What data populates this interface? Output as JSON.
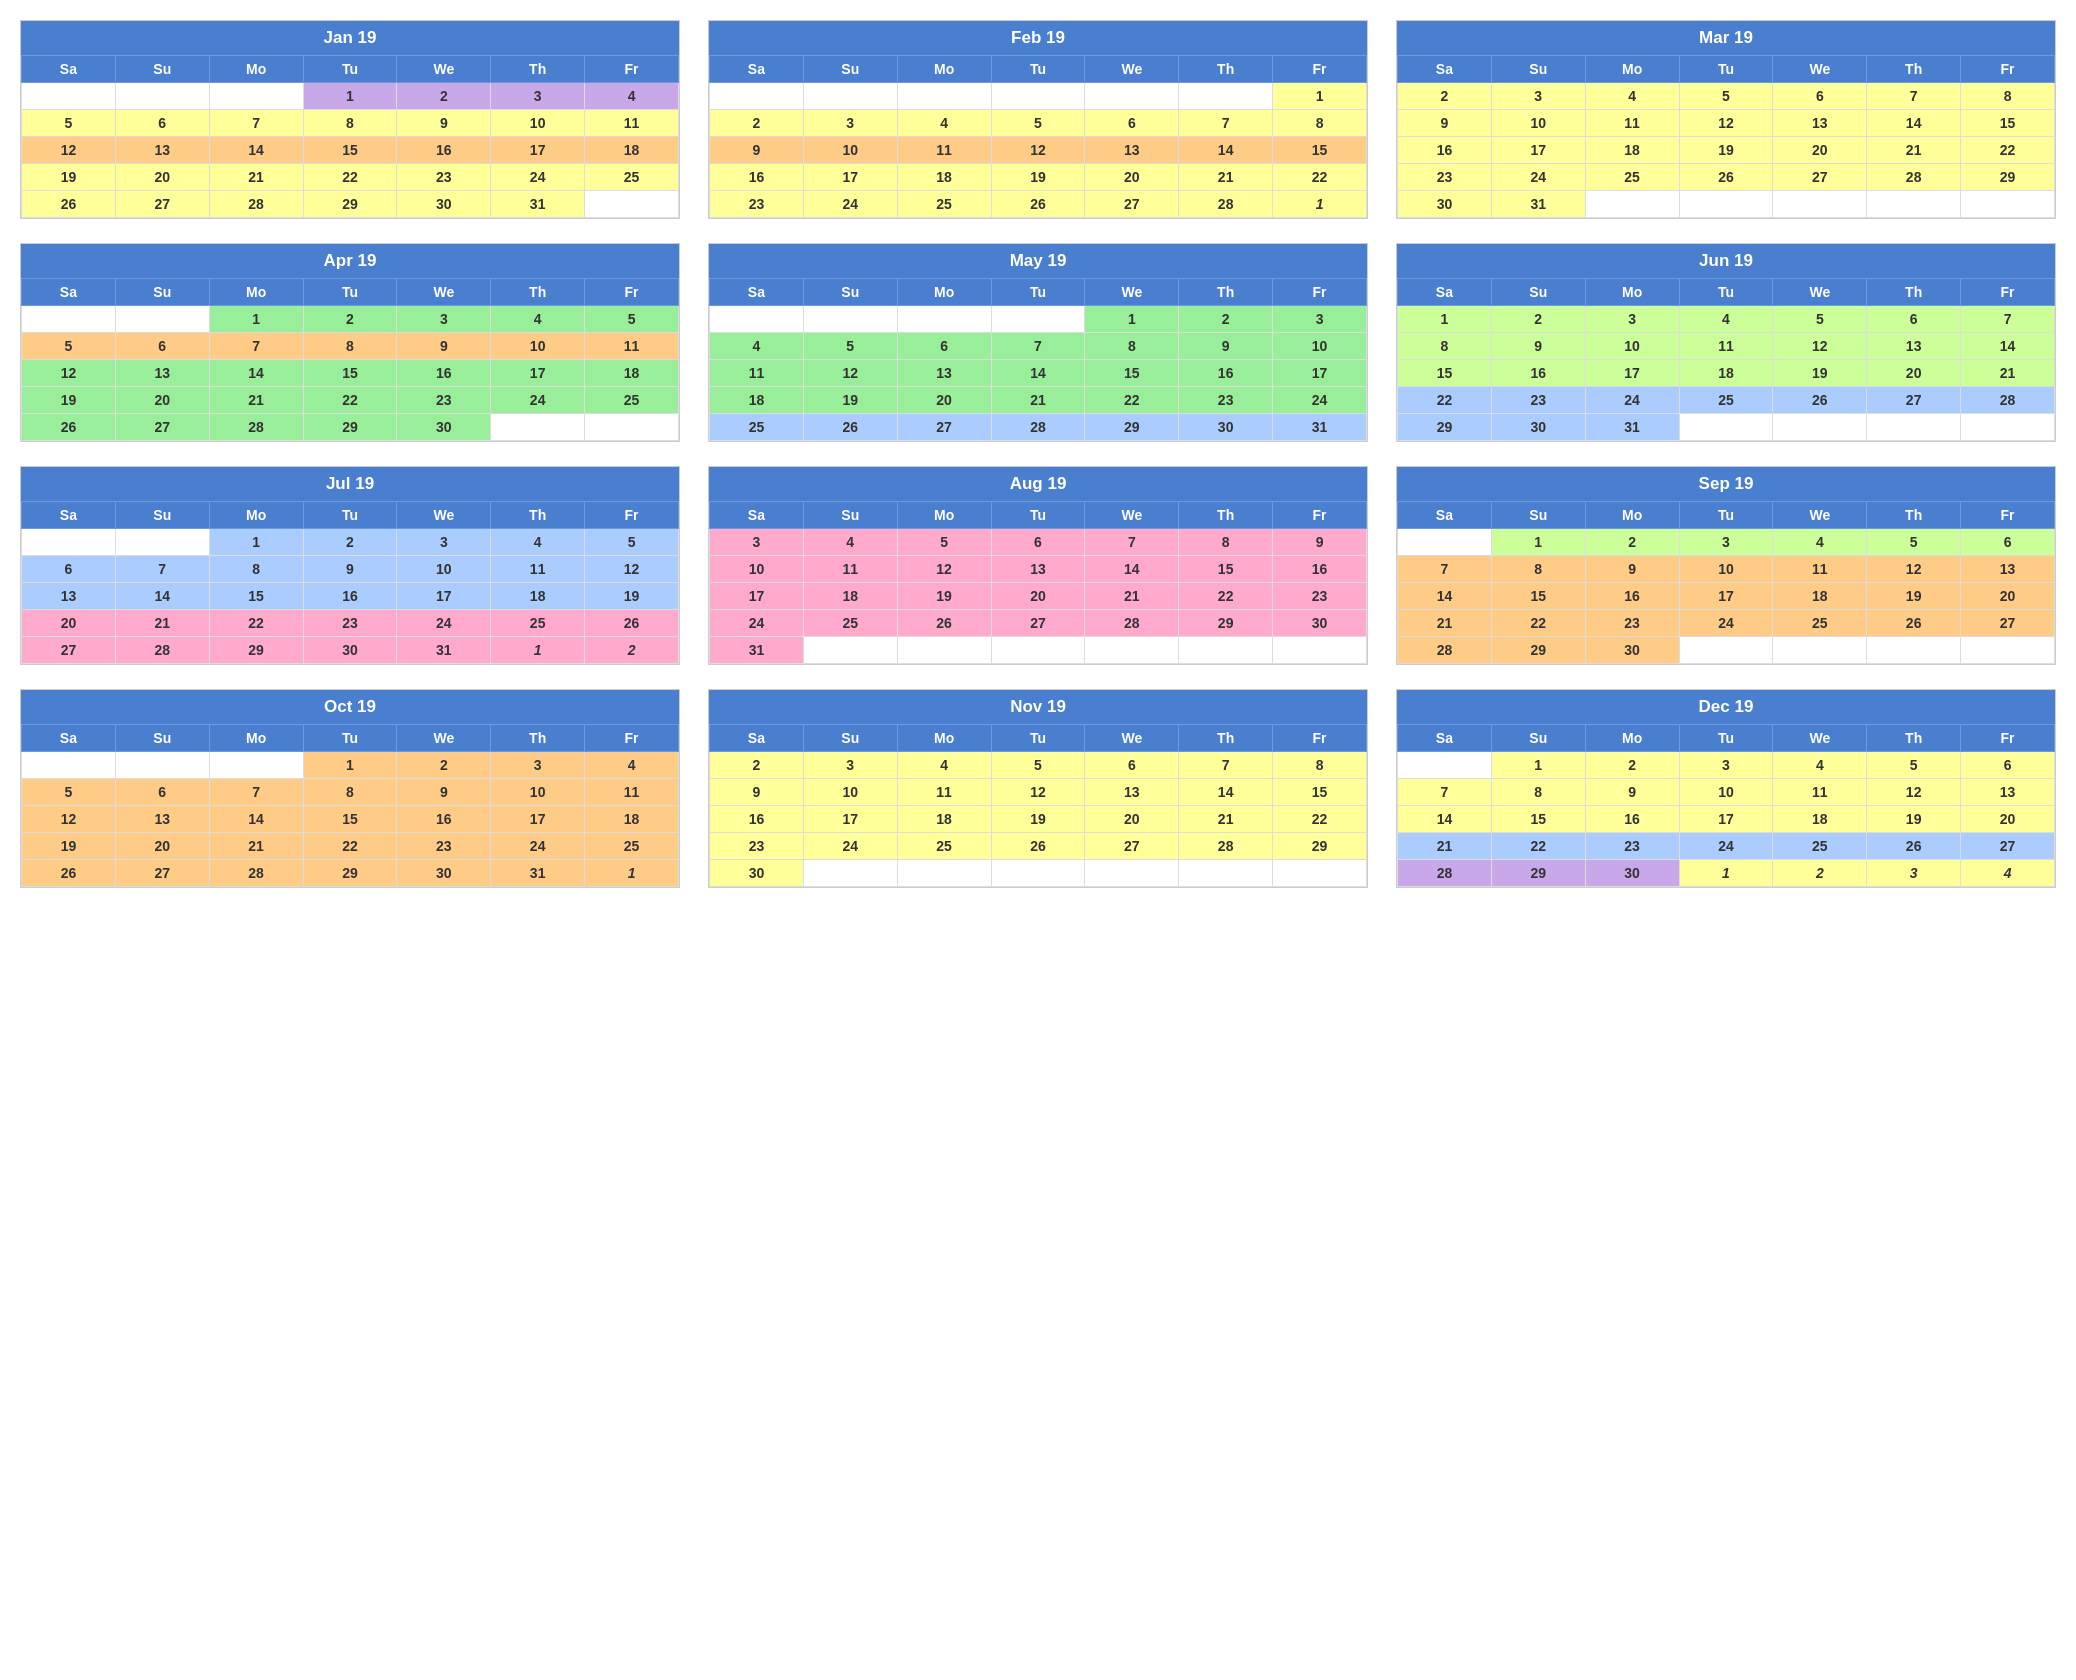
{
  "months": [
    {
      "name": "Jan 19",
      "days": [
        "Sa",
        "Su",
        "Mo",
        "Tu",
        "We",
        "Th",
        "Fr"
      ],
      "rows": [
        [
          "",
          "",
          "",
          "1",
          "2",
          "3",
          "4"
        ],
        [
          "5",
          "6",
          "7",
          "8",
          "9",
          "10",
          "11"
        ],
        [
          "12",
          "13",
          "14",
          "15",
          "16",
          "17",
          "18"
        ],
        [
          "19",
          "20",
          "21",
          "22",
          "23",
          "24",
          "25"
        ],
        [
          "26",
          "27",
          "28",
          "29",
          "30",
          "31",
          ""
        ]
      ],
      "colors": [
        [
          "empty",
          "empty",
          "empty",
          "purple",
          "purple",
          "purple",
          "purple"
        ],
        [
          "yellow",
          "yellow",
          "yellow",
          "yellow",
          "yellow",
          "yellow",
          "yellow"
        ],
        [
          "orange",
          "orange",
          "orange",
          "orange",
          "orange",
          "orange",
          "orange"
        ],
        [
          "yellow",
          "yellow",
          "yellow",
          "yellow",
          "yellow",
          "yellow",
          "yellow"
        ],
        [
          "yellow",
          "yellow",
          "yellow",
          "yellow",
          "yellow",
          "yellow",
          "empty"
        ]
      ]
    },
    {
      "name": "Feb 19",
      "days": [
        "Sa",
        "Su",
        "Mo",
        "Tu",
        "We",
        "Th",
        "Fr"
      ],
      "rows": [
        [
          "",
          "",
          "",
          "",
          "",
          "",
          "1"
        ],
        [
          "2",
          "3",
          "4",
          "5",
          "6",
          "7",
          "8"
        ],
        [
          "9",
          "10",
          "11",
          "12",
          "13",
          "14",
          "15"
        ],
        [
          "16",
          "17",
          "18",
          "19",
          "20",
          "21",
          "22"
        ],
        [
          "23",
          "24",
          "25",
          "26",
          "27",
          "28",
          "1"
        ]
      ],
      "colors": [
        [
          "empty",
          "empty",
          "empty",
          "empty",
          "empty",
          "empty",
          "yellow"
        ],
        [
          "yellow",
          "yellow",
          "yellow",
          "yellow",
          "yellow",
          "yellow",
          "yellow"
        ],
        [
          "orange",
          "orange",
          "orange",
          "orange",
          "orange",
          "orange",
          "orange"
        ],
        [
          "yellow",
          "yellow",
          "yellow",
          "yellow",
          "yellow",
          "yellow",
          "yellow"
        ],
        [
          "yellow",
          "yellow",
          "yellow",
          "yellow",
          "yellow",
          "yellow",
          "italic yellow"
        ]
      ]
    },
    {
      "name": "Mar 19",
      "days": [
        "Sa",
        "Su",
        "Mo",
        "Tu",
        "We",
        "Th",
        "Fr"
      ],
      "rows": [
        [
          "2",
          "3",
          "4",
          "5",
          "6",
          "7",
          "8"
        ],
        [
          "9",
          "10",
          "11",
          "12",
          "13",
          "14",
          "15"
        ],
        [
          "16",
          "17",
          "18",
          "19",
          "20",
          "21",
          "22"
        ],
        [
          "23",
          "24",
          "25",
          "26",
          "27",
          "28",
          "29"
        ],
        [
          "30",
          "31",
          "",
          "",
          "",
          "",
          ""
        ]
      ],
      "colors": [
        [
          "yellow",
          "yellow",
          "yellow",
          "yellow",
          "yellow",
          "yellow",
          "yellow"
        ],
        [
          "yellow",
          "yellow",
          "yellow",
          "yellow",
          "yellow",
          "yellow",
          "yellow"
        ],
        [
          "yellow",
          "yellow",
          "yellow",
          "yellow",
          "yellow",
          "yellow",
          "yellow"
        ],
        [
          "yellow",
          "yellow",
          "yellow",
          "yellow",
          "yellow",
          "yellow",
          "yellow"
        ],
        [
          "yellow",
          "yellow",
          "empty",
          "empty",
          "empty",
          "empty",
          "empty"
        ]
      ]
    },
    {
      "name": "Apr 19",
      "days": [
        "Sa",
        "Su",
        "Mo",
        "Tu",
        "We",
        "Th",
        "Fr"
      ],
      "rows": [
        [
          "",
          "",
          "1",
          "2",
          "3",
          "4",
          "5"
        ],
        [
          "5",
          "6",
          "7",
          "8",
          "9",
          "10",
          "11"
        ],
        [
          "12",
          "13",
          "14",
          "15",
          "16",
          "17",
          "18"
        ],
        [
          "19",
          "20",
          "21",
          "22",
          "23",
          "24",
          "25"
        ],
        [
          "26",
          "27",
          "28",
          "29",
          "30",
          "",
          ""
        ]
      ],
      "colors": [
        [
          "empty",
          "empty",
          "green",
          "green",
          "green",
          "green",
          "green"
        ],
        [
          "orange",
          "orange",
          "orange",
          "orange",
          "orange",
          "orange",
          "orange"
        ],
        [
          "green",
          "green",
          "green",
          "green",
          "green",
          "green",
          "green"
        ],
        [
          "green",
          "green",
          "green",
          "green",
          "green",
          "green",
          "green"
        ],
        [
          "green",
          "green",
          "green",
          "green",
          "green",
          "empty",
          "empty"
        ]
      ]
    },
    {
      "name": "May 19",
      "days": [
        "Sa",
        "Su",
        "Mo",
        "Tu",
        "We",
        "Th",
        "Fr"
      ],
      "rows": [
        [
          "",
          "",
          "",
          "",
          "1",
          "2",
          "3"
        ],
        [
          "4",
          "5",
          "6",
          "7",
          "8",
          "9",
          "10"
        ],
        [
          "11",
          "12",
          "13",
          "14",
          "15",
          "16",
          "17"
        ],
        [
          "18",
          "19",
          "20",
          "21",
          "22",
          "23",
          "24"
        ],
        [
          "25",
          "26",
          "27",
          "28",
          "29",
          "30",
          "31"
        ]
      ],
      "colors": [
        [
          "empty",
          "empty",
          "empty",
          "empty",
          "green",
          "green",
          "green"
        ],
        [
          "green",
          "green",
          "green",
          "green",
          "green",
          "green",
          "green"
        ],
        [
          "green",
          "green",
          "green",
          "green",
          "green",
          "green",
          "green"
        ],
        [
          "green",
          "green",
          "green",
          "green",
          "green",
          "green",
          "green"
        ],
        [
          "blue",
          "blue",
          "blue",
          "blue",
          "blue",
          "blue",
          "blue"
        ]
      ]
    },
    {
      "name": "Jun 19",
      "days": [
        "Sa",
        "Su",
        "Mo",
        "Tu",
        "We",
        "Th",
        "Fr"
      ],
      "rows": [
        [
          "1",
          "2",
          "3",
          "4",
          "5",
          "6",
          "7"
        ],
        [
          "8",
          "9",
          "10",
          "11",
          "12",
          "13",
          "14"
        ],
        [
          "15",
          "16",
          "17",
          "18",
          "19",
          "20",
          "21"
        ],
        [
          "22",
          "23",
          "24",
          "25",
          "26",
          "27",
          "28"
        ],
        [
          "29",
          "30",
          "31",
          "",
          "",
          "",
          ""
        ]
      ],
      "colors": [
        [
          "lime",
          "lime",
          "lime",
          "lime",
          "lime",
          "lime",
          "lime"
        ],
        [
          "lime",
          "lime",
          "lime",
          "lime",
          "lime",
          "lime",
          "lime"
        ],
        [
          "lime",
          "lime",
          "lime",
          "lime",
          "lime",
          "lime",
          "lime"
        ],
        [
          "blue",
          "blue",
          "blue",
          "blue",
          "blue",
          "blue",
          "blue"
        ],
        [
          "blue",
          "blue",
          "blue",
          "empty",
          "empty",
          "empty",
          "empty"
        ]
      ]
    },
    {
      "name": "Jul 19",
      "days": [
        "Sa",
        "Su",
        "Mo",
        "Tu",
        "We",
        "Th",
        "Fr"
      ],
      "rows": [
        [
          "",
          "",
          "1",
          "2",
          "3",
          "4",
          "5"
        ],
        [
          "6",
          "7",
          "8",
          "9",
          "10",
          "11",
          "12"
        ],
        [
          "13",
          "14",
          "15",
          "16",
          "17",
          "18",
          "19"
        ],
        [
          "20",
          "21",
          "22",
          "23",
          "24",
          "25",
          "26"
        ],
        [
          "27",
          "28",
          "29",
          "30",
          "31",
          "1",
          "2"
        ]
      ],
      "colors": [
        [
          "empty",
          "empty",
          "blue",
          "blue",
          "blue",
          "blue",
          "blue"
        ],
        [
          "blue",
          "blue",
          "blue",
          "blue",
          "blue",
          "blue",
          "blue"
        ],
        [
          "blue",
          "blue",
          "blue",
          "blue",
          "blue",
          "blue",
          "blue"
        ],
        [
          "pink",
          "pink",
          "pink",
          "pink",
          "pink",
          "pink",
          "pink"
        ],
        [
          "pink",
          "pink",
          "pink",
          "pink",
          "pink",
          "italic pink",
          "italic pink"
        ]
      ]
    },
    {
      "name": "Aug 19",
      "days": [
        "Sa",
        "Su",
        "Mo",
        "Tu",
        "We",
        "Th",
        "Fr"
      ],
      "rows": [
        [
          "3",
          "4",
          "5",
          "6",
          "7",
          "8",
          "9"
        ],
        [
          "10",
          "11",
          "12",
          "13",
          "14",
          "15",
          "16"
        ],
        [
          "17",
          "18",
          "19",
          "20",
          "21",
          "22",
          "23"
        ],
        [
          "24",
          "25",
          "26",
          "27",
          "28",
          "29",
          "30"
        ],
        [
          "31",
          "",
          "",
          "",
          "",
          "",
          ""
        ]
      ],
      "colors": [
        [
          "pink",
          "pink",
          "pink",
          "pink",
          "pink",
          "pink",
          "pink"
        ],
        [
          "pink",
          "pink",
          "pink",
          "pink",
          "pink",
          "pink",
          "pink"
        ],
        [
          "pink",
          "pink",
          "pink",
          "pink",
          "pink",
          "pink",
          "pink"
        ],
        [
          "pink",
          "pink",
          "pink",
          "pink",
          "pink",
          "pink",
          "pink"
        ],
        [
          "pink",
          "empty",
          "empty",
          "empty",
          "empty",
          "empty",
          "empty"
        ]
      ]
    },
    {
      "name": "Sep 19",
      "days": [
        "Sa",
        "Su",
        "Mo",
        "Tu",
        "We",
        "Th",
        "Fr"
      ],
      "rows": [
        [
          "",
          "1",
          "2",
          "3",
          "4",
          "5",
          "6"
        ],
        [
          "7",
          "8",
          "9",
          "10",
          "11",
          "12",
          "13"
        ],
        [
          "14",
          "15",
          "16",
          "17",
          "18",
          "19",
          "20"
        ],
        [
          "21",
          "22",
          "23",
          "24",
          "25",
          "26",
          "27"
        ],
        [
          "28",
          "29",
          "30",
          "",
          "",
          "",
          ""
        ]
      ],
      "colors": [
        [
          "empty",
          "lime",
          "lime",
          "lime",
          "lime",
          "lime",
          "lime"
        ],
        [
          "orange",
          "orange",
          "orange",
          "orange",
          "orange",
          "orange",
          "orange"
        ],
        [
          "orange",
          "orange",
          "orange",
          "orange",
          "orange",
          "orange",
          "orange"
        ],
        [
          "orange",
          "orange",
          "orange",
          "orange",
          "orange",
          "orange",
          "orange"
        ],
        [
          "orange",
          "orange",
          "orange",
          "empty",
          "empty",
          "empty",
          "empty"
        ]
      ]
    },
    {
      "name": "Oct 19",
      "days": [
        "Sa",
        "Su",
        "Mo",
        "Tu",
        "We",
        "Th",
        "Fr"
      ],
      "rows": [
        [
          "",
          "",
          "",
          "1",
          "2",
          "3",
          "4"
        ],
        [
          "5",
          "6",
          "7",
          "8",
          "9",
          "10",
          "11"
        ],
        [
          "12",
          "13",
          "14",
          "15",
          "16",
          "17",
          "18"
        ],
        [
          "19",
          "20",
          "21",
          "22",
          "23",
          "24",
          "25"
        ],
        [
          "26",
          "27",
          "28",
          "29",
          "30",
          "31",
          "1"
        ]
      ],
      "colors": [
        [
          "empty",
          "empty",
          "empty",
          "orange",
          "orange",
          "orange",
          "orange"
        ],
        [
          "orange",
          "orange",
          "orange",
          "orange",
          "orange",
          "orange",
          "orange"
        ],
        [
          "orange",
          "orange",
          "orange",
          "orange",
          "orange",
          "orange",
          "orange"
        ],
        [
          "orange",
          "orange",
          "orange",
          "orange",
          "orange",
          "orange",
          "orange"
        ],
        [
          "orange",
          "orange",
          "orange",
          "orange",
          "orange",
          "orange",
          "italic orange"
        ]
      ]
    },
    {
      "name": "Nov 19",
      "days": [
        "Sa",
        "Su",
        "Mo",
        "Tu",
        "We",
        "Th",
        "Fr"
      ],
      "rows": [
        [
          "2",
          "3",
          "4",
          "5",
          "6",
          "7",
          "8"
        ],
        [
          "9",
          "10",
          "11",
          "12",
          "13",
          "14",
          "15"
        ],
        [
          "16",
          "17",
          "18",
          "19",
          "20",
          "21",
          "22"
        ],
        [
          "23",
          "24",
          "25",
          "26",
          "27",
          "28",
          "29"
        ],
        [
          "30",
          "",
          "",
          "",
          "",
          "",
          ""
        ]
      ],
      "colors": [
        [
          "yellow",
          "yellow",
          "yellow",
          "yellow",
          "yellow",
          "yellow",
          "yellow"
        ],
        [
          "yellow",
          "yellow",
          "yellow",
          "yellow",
          "yellow",
          "yellow",
          "yellow"
        ],
        [
          "yellow",
          "yellow",
          "yellow",
          "yellow",
          "yellow",
          "yellow",
          "yellow"
        ],
        [
          "yellow",
          "yellow",
          "yellow",
          "yellow",
          "yellow",
          "yellow",
          "yellow"
        ],
        [
          "yellow",
          "empty",
          "empty",
          "empty",
          "empty",
          "empty",
          "empty"
        ]
      ]
    },
    {
      "name": "Dec 19",
      "days": [
        "Sa",
        "Su",
        "Mo",
        "Tu",
        "We",
        "Th",
        "Fr"
      ],
      "rows": [
        [
          "",
          "1",
          "2",
          "3",
          "4",
          "5",
          "6"
        ],
        [
          "7",
          "8",
          "9",
          "10",
          "11",
          "12",
          "13"
        ],
        [
          "14",
          "15",
          "16",
          "17",
          "18",
          "19",
          "20"
        ],
        [
          "21",
          "22",
          "23",
          "24",
          "25",
          "26",
          "27"
        ],
        [
          "28",
          "29",
          "30",
          "1",
          "2",
          "3",
          "4"
        ]
      ],
      "colors": [
        [
          "empty",
          "yellow",
          "yellow",
          "yellow",
          "yellow",
          "yellow",
          "yellow"
        ],
        [
          "yellow",
          "yellow",
          "yellow",
          "yellow",
          "yellow",
          "yellow",
          "yellow"
        ],
        [
          "yellow",
          "yellow",
          "yellow",
          "yellow",
          "yellow",
          "yellow",
          "yellow"
        ],
        [
          "blue",
          "blue",
          "blue",
          "blue",
          "blue",
          "blue",
          "blue"
        ],
        [
          "purple",
          "purple",
          "purple",
          "italic yellow",
          "italic yellow",
          "italic yellow",
          "italic yellow"
        ]
      ]
    }
  ]
}
